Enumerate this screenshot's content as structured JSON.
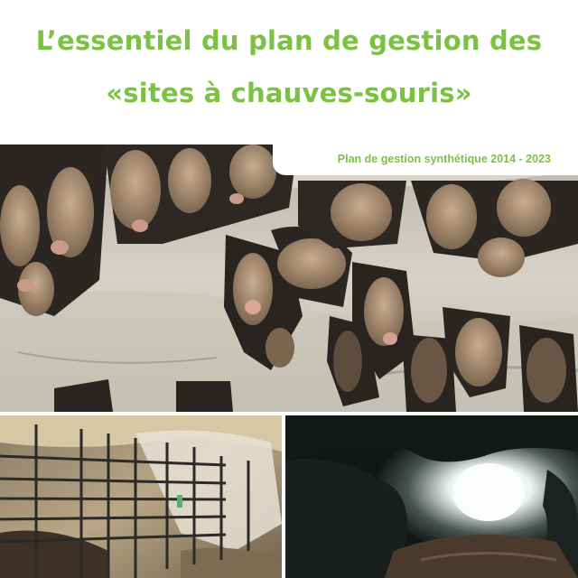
{
  "title": {
    "line1": "L’essentiel du plan de gestion des",
    "line2": "«sites à chauves-souris»"
  },
  "subtitle": "Plan de gestion synthétique 2014 - 2023",
  "colors": {
    "accent": "#7cc242"
  },
  "photos": {
    "top": "bats-hanging-from-cave-ceiling",
    "bottom_left": "metal-cage-gate-in-cave",
    "bottom_right": "cave-entrance-seen-from-inside"
  }
}
